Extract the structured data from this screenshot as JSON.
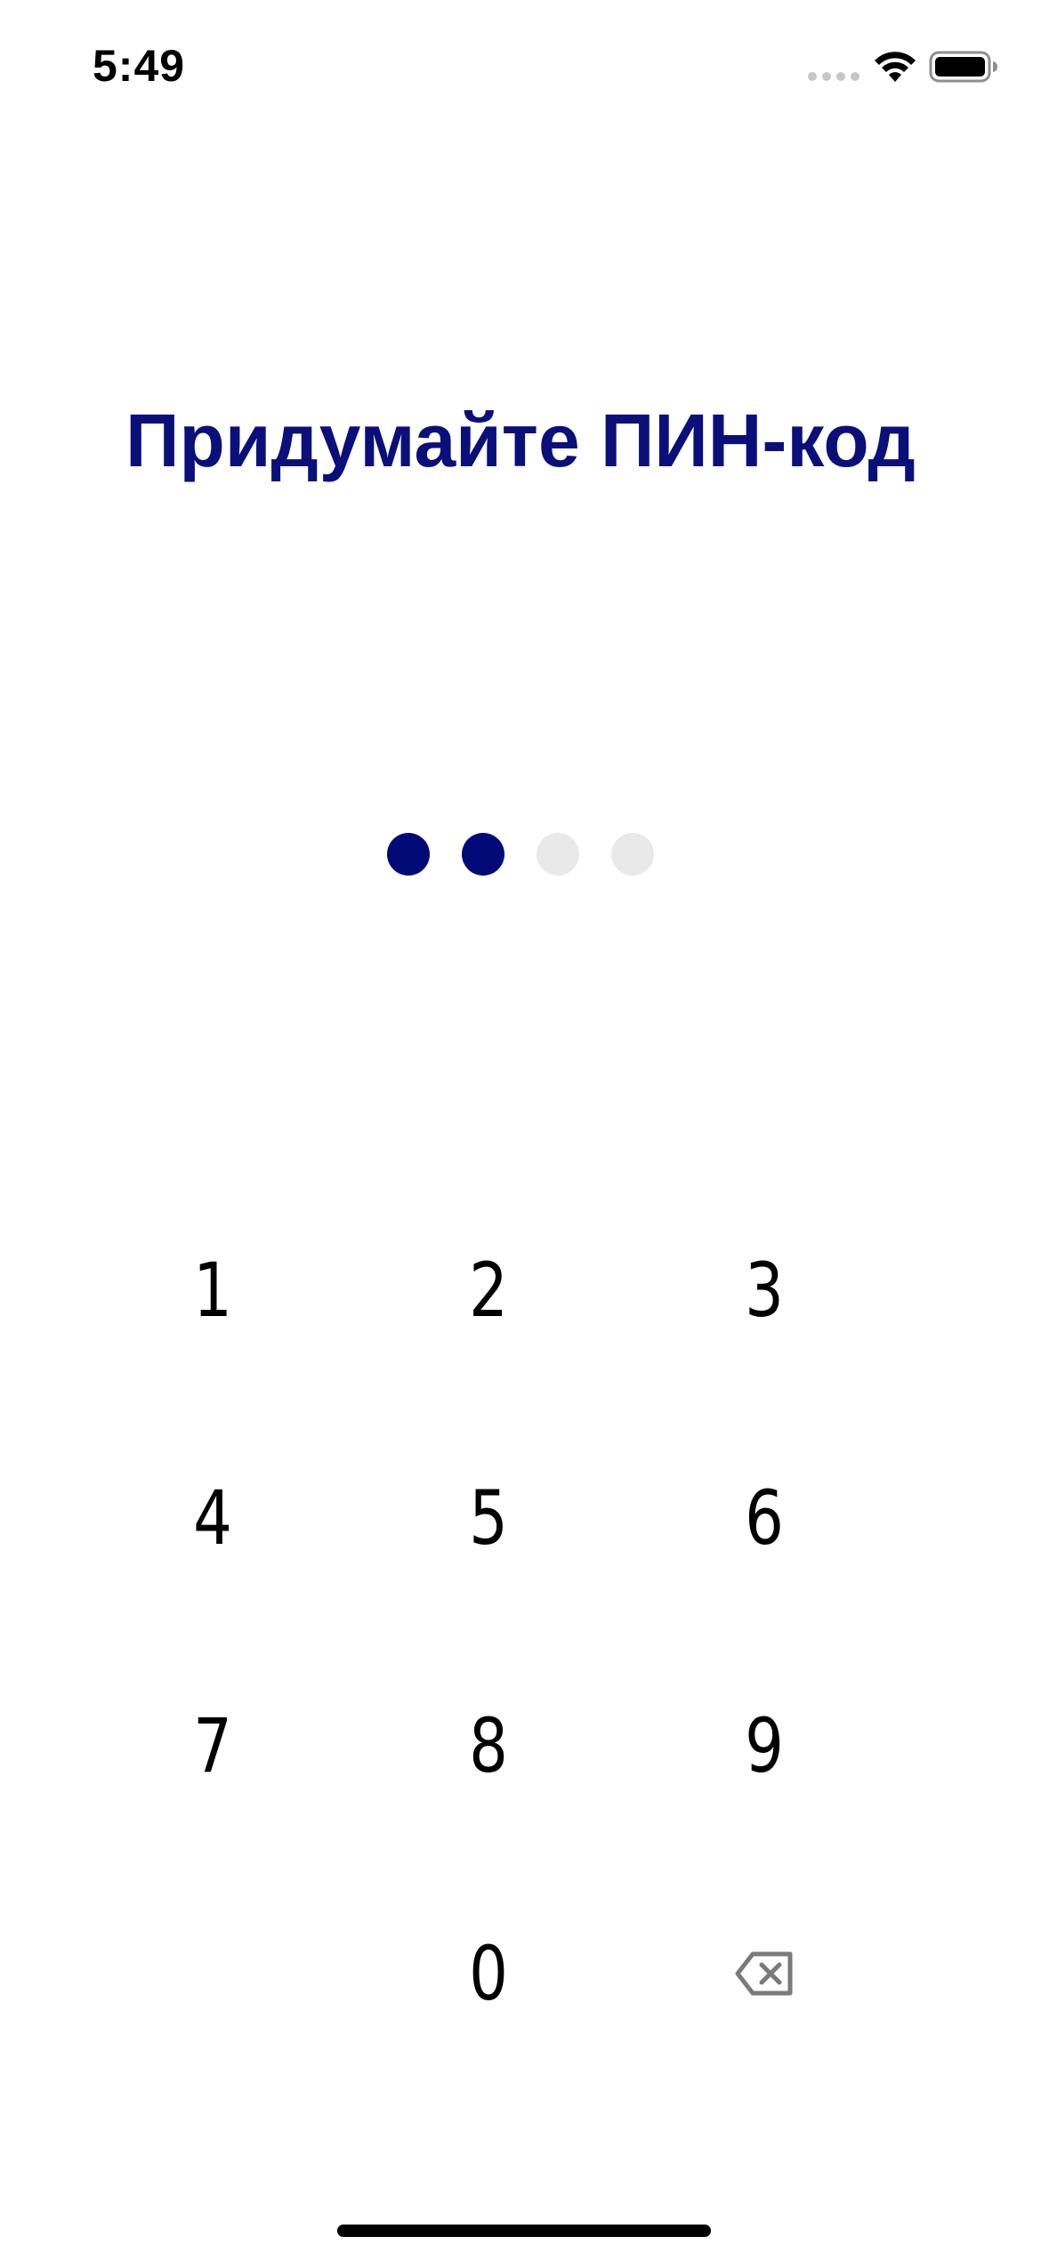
{
  "status_bar": {
    "time": "5:49",
    "signal_icon": "cellular-signal-icon",
    "wifi_icon": "wifi-icon",
    "battery_icon": "battery-icon"
  },
  "title": "Придумайте ПИН-код",
  "pin": {
    "length": 4,
    "entered": 2,
    "filled_color": "#020a78",
    "empty_color": "#e9e9e9"
  },
  "keypad": {
    "keys": [
      "1",
      "2",
      "3",
      "4",
      "5",
      "6",
      "7",
      "8",
      "9",
      "",
      "0",
      "backspace-icon"
    ]
  },
  "colors": {
    "accent": "#0a0f7a",
    "background": "#ffffff",
    "text": "#000000"
  }
}
